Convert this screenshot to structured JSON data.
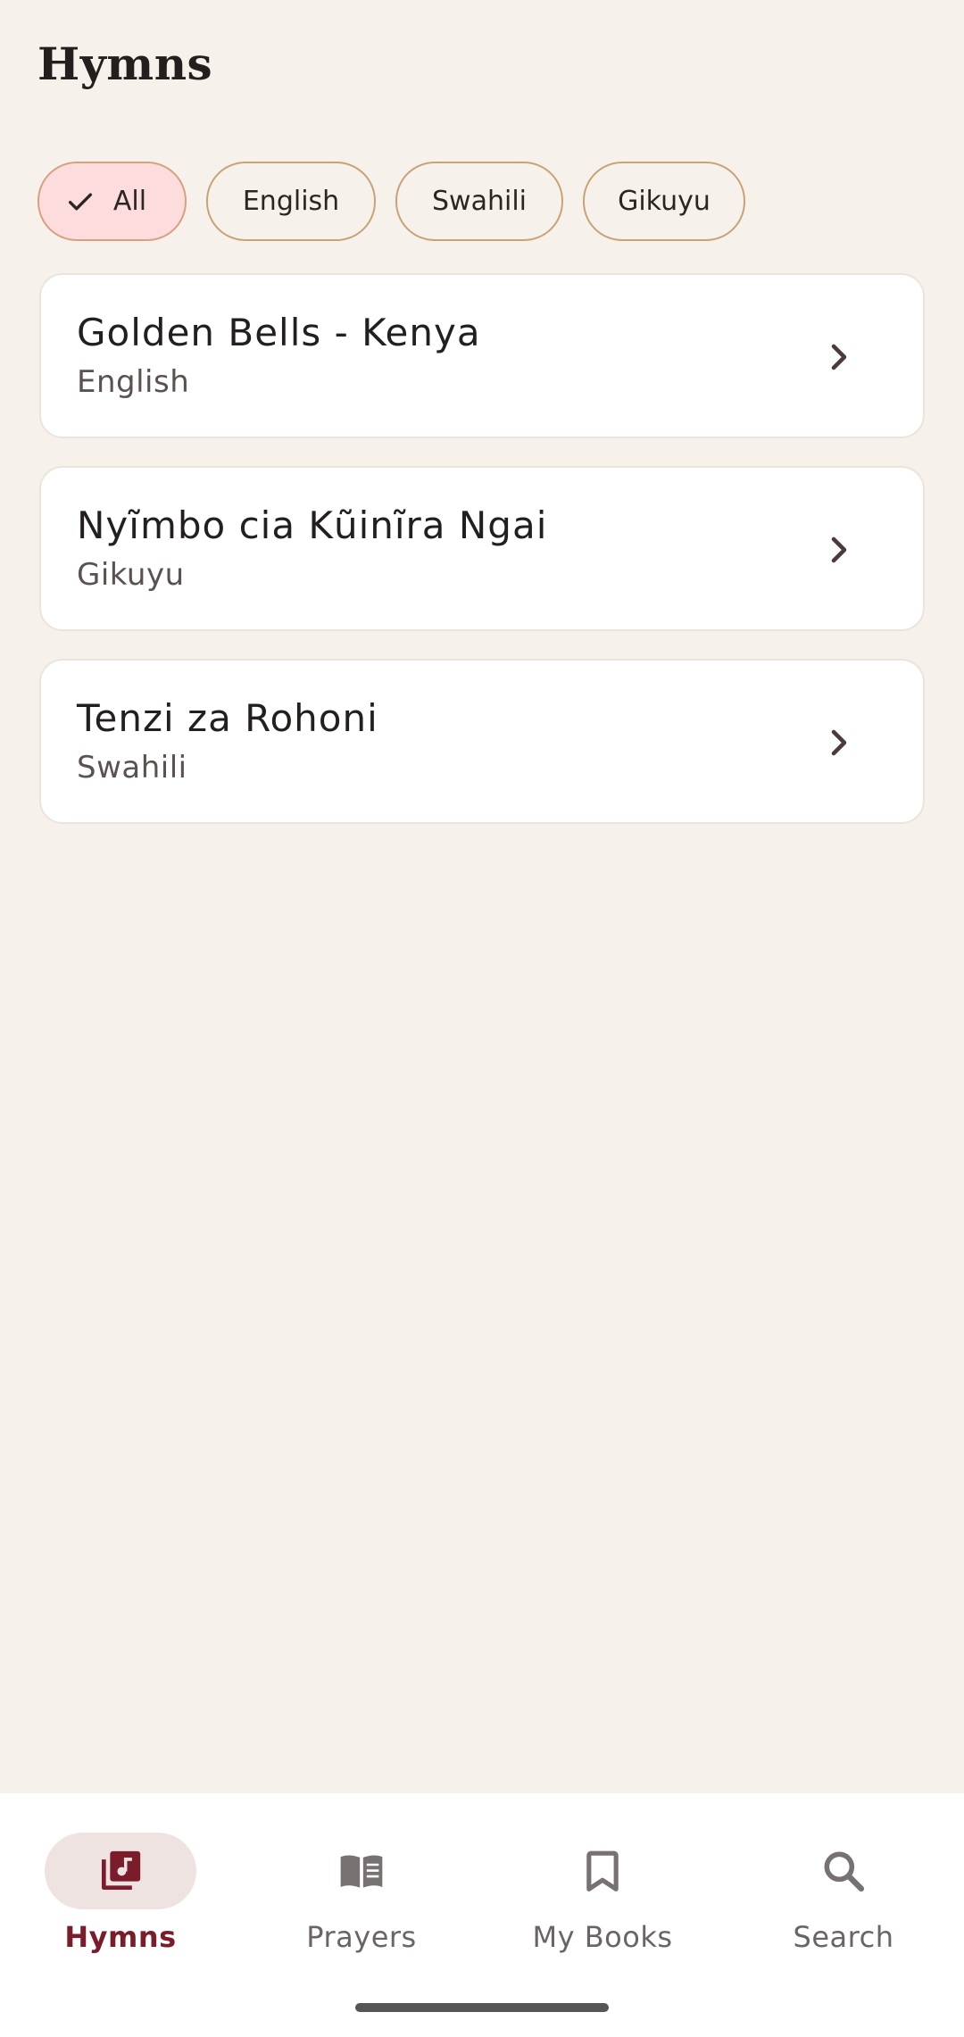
{
  "header": {
    "title": "Hymns"
  },
  "filters": {
    "chips": [
      {
        "label": "All",
        "selected": true
      },
      {
        "label": "English",
        "selected": false
      },
      {
        "label": "Swahili",
        "selected": false
      },
      {
        "label": "Gikuyu",
        "selected": false
      }
    ]
  },
  "books": [
    {
      "title": "Golden Bells - Kenya",
      "language": "English"
    },
    {
      "title": "Nyĩmbo cia Kũinĩra Ngai",
      "language": "Gikuyu"
    },
    {
      "title": "Tenzi za Rohoni",
      "language": "Swahili"
    }
  ],
  "nav": {
    "items": [
      {
        "label": "Hymns",
        "icon": "music-library-icon",
        "active": true
      },
      {
        "label": "Prayers",
        "icon": "open-book-icon",
        "active": false
      },
      {
        "label": "My Books",
        "icon": "bookmark-icon",
        "active": false
      },
      {
        "label": "Search",
        "icon": "search-icon",
        "active": false
      }
    ]
  },
  "colors": {
    "background": "#f6f1ea",
    "accent": "#7a1c2a",
    "chip_selected": "#fcdcdc",
    "chip_border": "#c9a276"
  }
}
